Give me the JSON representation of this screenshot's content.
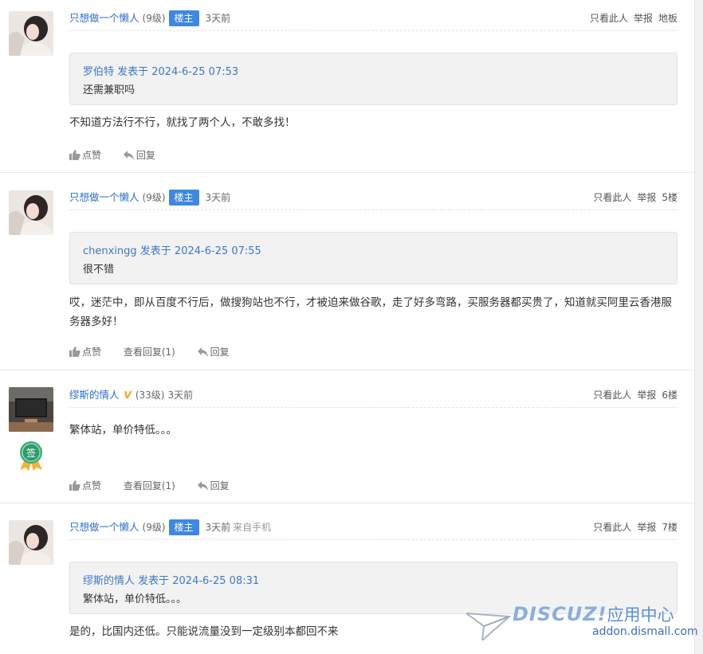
{
  "posts": [
    {
      "user": "只想做一个懒人",
      "level": "(9级)",
      "owner": "楼主",
      "time": "3天前",
      "device": "",
      "right": [
        "只看此人",
        "举报",
        "地板"
      ],
      "quote": {
        "meta": "罗伯特 发表于 2024-6-25 07:53",
        "text": "还需兼职吗"
      },
      "content": "不知道方法行不行，就找了两个人，不敢多找！",
      "actions": {
        "like": "点赞",
        "view": "",
        "reply": "回复"
      }
    },
    {
      "user": "只想做一个懒人",
      "level": "(9级)",
      "owner": "楼主",
      "time": "3天前",
      "device": "",
      "right": [
        "只看此人",
        "举报",
        "5楼"
      ],
      "quote": {
        "meta": "chenxingg 发表于 2024-6-25 07:55",
        "text": "很不错"
      },
      "content": "哎，迷茫中，即从百度不行后，做搜狗站也不行，才被迫来做谷歌，走了好多弯路，买服务器都买贵了，知道就买阿里云香港服务器多好！",
      "actions": {
        "like": "点赞",
        "view": "查看回复(1)",
        "reply": "回复"
      }
    },
    {
      "user": "缪斯的情人",
      "level": "(33级)",
      "owner": "",
      "time": "3天前",
      "device": "",
      "badge": "签",
      "right": [
        "只看此人",
        "举报",
        "6楼"
      ],
      "content": "繁体站，单价特低。。。",
      "actions": {
        "like": "点赞",
        "view": "查看回复(1)",
        "reply": "回复"
      }
    },
    {
      "user": "只想做一个懒人",
      "level": "(9级)",
      "owner": "楼主",
      "time": "3天前",
      "device": "来自手机",
      "right": [
        "只看此人",
        "举报",
        "7楼"
      ],
      "quote": {
        "meta": "缪斯的情人 发表于 2024-6-25 08:31",
        "text": "繁体站，单价特低。。。"
      },
      "content": "是的，比国内还低。只能说流量没到一定级别本都回不来"
    }
  ],
  "watermark": {
    "logo": "DISCUZ!",
    "cn": "应用中心",
    "url": "addon.dismall.com"
  },
  "colors": {
    "link": "#2f6fc2",
    "owner_badge": "#3e88e0",
    "quote_bg": "#f2f2f2"
  }
}
